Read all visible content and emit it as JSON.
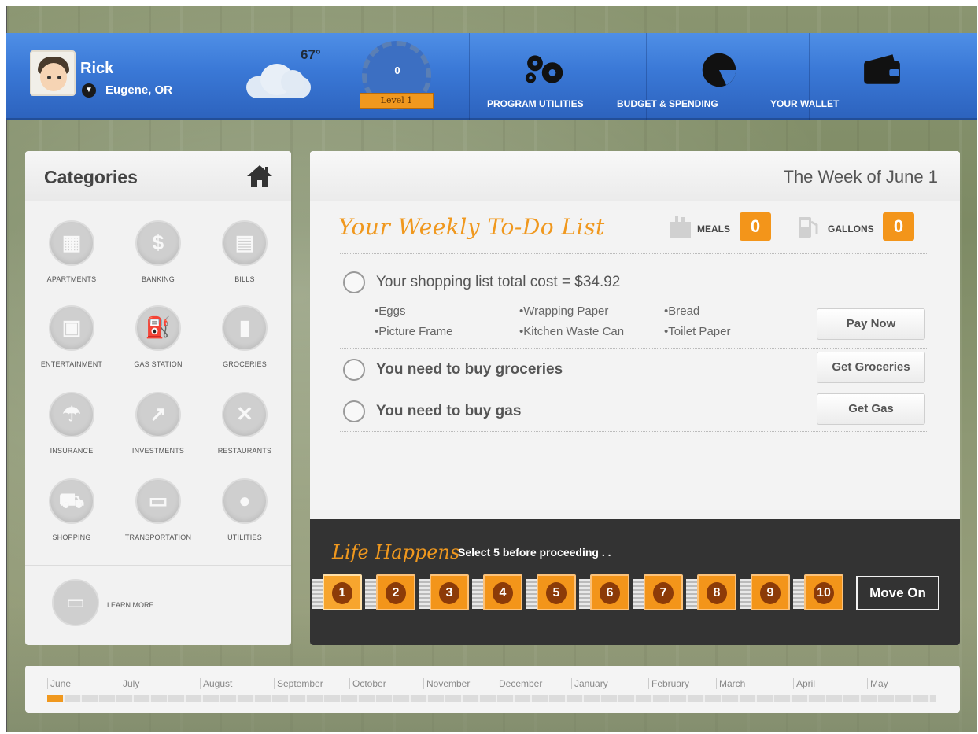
{
  "user": {
    "name": "Rick",
    "location": "Eugene, OR"
  },
  "weather": {
    "temp": "67°",
    "icon": "cloud-icon"
  },
  "progress": {
    "score": "0",
    "level": "Level 1"
  },
  "nav": [
    {
      "label": "PROGRAM UTILITIES",
      "icon": "gears-icon"
    },
    {
      "label": "BUDGET & SPENDING",
      "icon": "pie-chart-icon"
    },
    {
      "label": "YOUR WALLET",
      "icon": "wallet-icon"
    }
  ],
  "categories": {
    "title": "Categories",
    "items": [
      {
        "label": "APARTMENTS",
        "glyph": "▦"
      },
      {
        "label": "BANKING",
        "glyph": "$"
      },
      {
        "label": "BILLS",
        "glyph": "▤"
      },
      {
        "label": "ENTERTAINMENT",
        "glyph": "▣"
      },
      {
        "label": "GAS STATION",
        "glyph": "⛽"
      },
      {
        "label": "GROCERIES",
        "glyph": "▮"
      },
      {
        "label": "INSURANCE",
        "glyph": "☂"
      },
      {
        "label": "INVESTMENTS",
        "glyph": "↗"
      },
      {
        "label": "RESTAURANTS",
        "glyph": "✕"
      },
      {
        "label": "SHOPPING",
        "glyph": "⛟"
      },
      {
        "label": "TRANSPORTATION",
        "glyph": "▭"
      },
      {
        "label": "UTILITIES",
        "glyph": "●"
      }
    ],
    "learn_more": "LEARN MORE"
  },
  "main": {
    "week": "The Week of June 1",
    "todo_title": "Your Weekly To-Do List",
    "meals": {
      "label": "MEALS",
      "value": "0"
    },
    "gallons": {
      "label": "GALLONS",
      "value": "0"
    },
    "shopping": {
      "title": "Your shopping list total cost = $34.92",
      "items": [
        "•Eggs",
        "•Wrapping Paper",
        "•Bread",
        "•Picture Frame",
        "•Kitchen Waste Can",
        "•Toilet Paper"
      ],
      "button": "Pay Now"
    },
    "groceries": {
      "title": "You need to buy groceries",
      "button": "Get Groceries"
    },
    "gas": {
      "title": "You need to buy gas",
      "button": "Get Gas"
    }
  },
  "life": {
    "title": "Life Happens",
    "subtitle": "Select 5 before proceeding . .",
    "tickets": [
      "1",
      "2",
      "3",
      "4",
      "5",
      "6",
      "7",
      "8",
      "9",
      "10"
    ],
    "move_on": "Move On"
  },
  "timeline": {
    "months": [
      "June",
      "July",
      "August",
      "September",
      "October",
      "November",
      "December",
      "January",
      "February",
      "March",
      "April",
      "May"
    ],
    "progress": 0.018
  },
  "colors": {
    "accent": "#f0981e",
    "header": "#3a78d6",
    "dark": "#333333"
  }
}
